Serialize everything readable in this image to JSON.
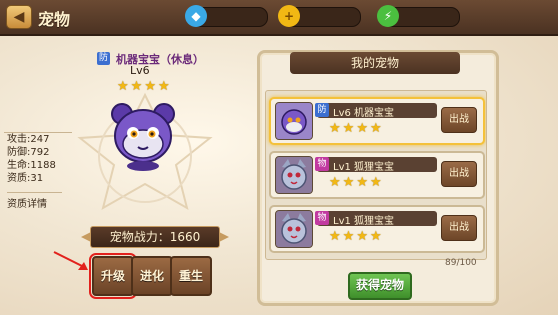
{
  "header": {
    "back_icon": "back-arrow-icon",
    "title": "宠物",
    "resources": [
      {
        "icon": "diamond-icon",
        "value": ""
      },
      {
        "icon": "gold-coin-icon",
        "value": ""
      },
      {
        "icon": "energy-icon",
        "value": ""
      }
    ]
  },
  "pet_detail": {
    "type_badge": "防",
    "name": "机器宝宝（休息）",
    "level": "Lv6",
    "stars": 4,
    "stats": [
      "攻击:247",
      "防御:792",
      "生命:1188",
      "资质:31"
    ],
    "detail_link": "资质详情",
    "power_label": "宠物战力：1660",
    "actions": [
      "升级",
      "进化",
      "重生"
    ]
  },
  "pet_list": {
    "title": "我的宠物",
    "items": [
      {
        "badge": "防",
        "badge_color": "#3c6fd0",
        "name": "Lv6  机器宝宝",
        "stars": 4,
        "action": "出战",
        "selected": true
      },
      {
        "badge": "物",
        "badge_color": "#c13aa0",
        "name": "Lv1  狐狸宝宝",
        "stars": 4,
        "action": "出战",
        "selected": false
      },
      {
        "badge": "物",
        "badge_color": "#c13aa0",
        "name": "Lv1  狐狸宝宝",
        "stars": 4,
        "action": "出战",
        "selected": false
      }
    ],
    "capacity": "89/100",
    "get_button": "获得宠物"
  },
  "colors": {
    "accent": "#f2b814",
    "highlight": "#e2211c",
    "green": "#3f8f2b"
  }
}
